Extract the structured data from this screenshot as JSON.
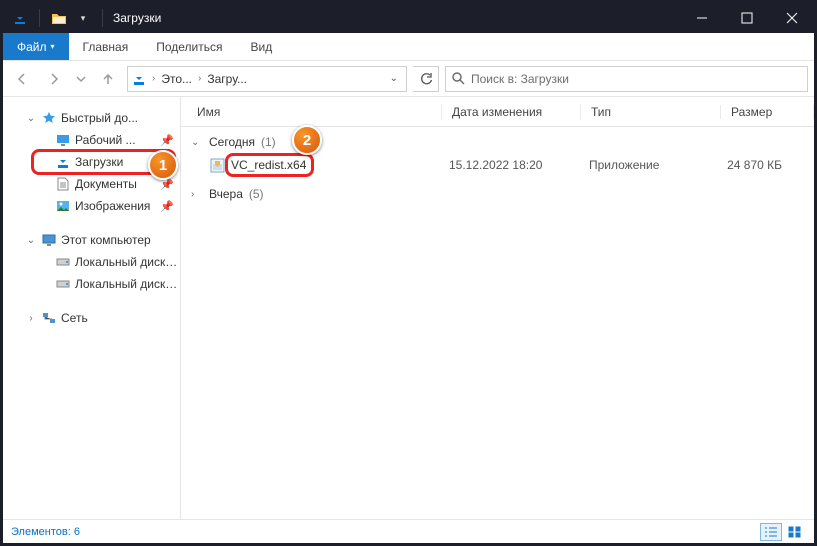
{
  "title": "Загрузки",
  "ribbon": {
    "file": "Файл",
    "tabs": [
      "Главная",
      "Поделиться",
      "Вид"
    ]
  },
  "breadcrumbs": {
    "c1": "Это...",
    "c2": "Загру..."
  },
  "search_placeholder": "Поиск в: Загрузки",
  "sidebar": {
    "quick": "Быстрый до...",
    "desktop": "Рабочий ...",
    "downloads": "Загрузки",
    "documents": "Документы",
    "pictures": "Изображения",
    "this_pc": "Этот компьютер",
    "disk_c": "Локальный диск (C",
    "disk_d": "Локальный диск (D",
    "network": "Сеть"
  },
  "columns": {
    "name": "Имя",
    "date": "Дата изменения",
    "type": "Тип",
    "size": "Размер"
  },
  "groups": {
    "today": {
      "label": "Сегодня",
      "count": "(1)"
    },
    "yesterday": {
      "label": "Вчера",
      "count": "(5)"
    }
  },
  "file": {
    "name": "VC_redist.x64",
    "date": "15.12.2022 18:20",
    "type": "Приложение",
    "size": "24 870 КБ"
  },
  "status": "Элементов: 6",
  "badges": {
    "b1": "1",
    "b2": "2"
  }
}
